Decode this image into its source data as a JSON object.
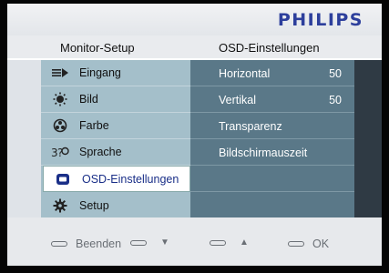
{
  "brand": "PHILIPS",
  "header": {
    "left_title": "Monitor-Setup",
    "right_title": "OSD-Einstellungen"
  },
  "menu": {
    "items": [
      {
        "label": "Eingang",
        "icon": "input-icon"
      },
      {
        "label": "Bild",
        "icon": "brightness-icon"
      },
      {
        "label": "Farbe",
        "icon": "color-palette-icon"
      },
      {
        "label": "Sprache",
        "icon": "language-icon"
      },
      {
        "label": "OSD-Einstellungen",
        "icon": "osd-icon",
        "selected": true
      },
      {
        "label": "Setup",
        "icon": "gear-icon"
      }
    ]
  },
  "submenu": {
    "items": [
      {
        "label": "Horizontal",
        "value": "50"
      },
      {
        "label": "Vertikal",
        "value": "50"
      },
      {
        "label": "Transparenz",
        "value": ""
      },
      {
        "label": "Bildschirmauszeit",
        "value": ""
      }
    ]
  },
  "footer": {
    "exit_label": "Beenden",
    "down_symbol": "▼",
    "up_symbol": "▲",
    "ok_label": "OK"
  },
  "colors": {
    "brand": "#2d3f9c",
    "left_panel": "#a4bfca",
    "right_panel": "#5a7888",
    "selected_text": "#1a2f88"
  }
}
